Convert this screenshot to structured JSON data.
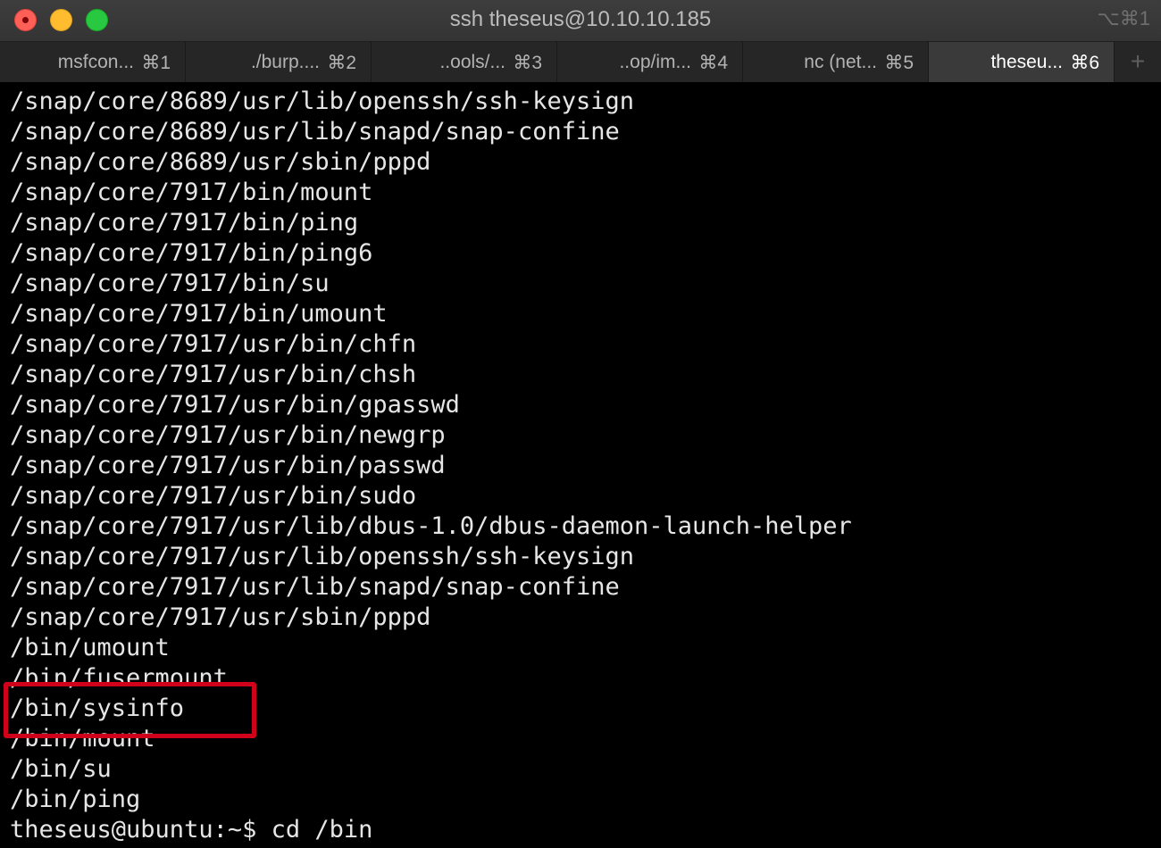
{
  "window": {
    "title": "ssh theseus@10.10.10.185",
    "shortcut": "⌥⌘1",
    "traffic_lights": [
      "close",
      "minimize",
      "zoom"
    ],
    "colors": {
      "close": "#fe5f57",
      "minimize": "#febc2e",
      "zoom": "#28c840",
      "terminal_bg": "#000000",
      "terminal_fg": "#e6e6e6",
      "highlight": "#d0021b"
    }
  },
  "tabs": [
    {
      "label": "msfcon...",
      "key": "⌘1",
      "active": false
    },
    {
      "label": "./burp....",
      "key": "⌘2",
      "active": false
    },
    {
      "label": "..ools/...",
      "key": "⌘3",
      "active": false
    },
    {
      "label": "..op/im...",
      "key": "⌘4",
      "active": false
    },
    {
      "label": "nc (net...",
      "key": "⌘5",
      "active": false
    },
    {
      "label": "theseu...",
      "key": "⌘6",
      "active": true
    }
  ],
  "new_tab_label": "+",
  "terminal": {
    "lines": [
      "/snap/core/8689/usr/lib/openssh/ssh-keysign",
      "/snap/core/8689/usr/lib/snapd/snap-confine",
      "/snap/core/8689/usr/sbin/pppd",
      "/snap/core/7917/bin/mount",
      "/snap/core/7917/bin/ping",
      "/snap/core/7917/bin/ping6",
      "/snap/core/7917/bin/su",
      "/snap/core/7917/bin/umount",
      "/snap/core/7917/usr/bin/chfn",
      "/snap/core/7917/usr/bin/chsh",
      "/snap/core/7917/usr/bin/gpasswd",
      "/snap/core/7917/usr/bin/newgrp",
      "/snap/core/7917/usr/bin/passwd",
      "/snap/core/7917/usr/bin/sudo",
      "/snap/core/7917/usr/lib/dbus-1.0/dbus-daemon-launch-helper",
      "/snap/core/7917/usr/lib/openssh/ssh-keysign",
      "/snap/core/7917/usr/lib/snapd/snap-confine",
      "/snap/core/7917/usr/sbin/pppd",
      "/bin/umount",
      "/bin/fusermount",
      "/bin/sysinfo",
      "/bin/mount",
      "/bin/su",
      "/bin/ping",
      "theseus@ubuntu:~$ cd /bin"
    ],
    "highlighted_line": "/bin/sysinfo"
  }
}
